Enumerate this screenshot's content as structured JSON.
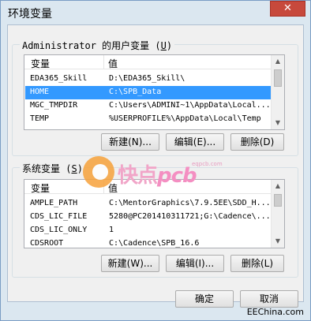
{
  "window": {
    "title": "环境变量",
    "close_label": "✕"
  },
  "user_vars": {
    "label_prefix": "Administrator 的用户变量 (",
    "label_key": "U",
    "label_suffix": ")",
    "col_name": "变量",
    "col_value": "值",
    "rows": [
      {
        "name": "EDA365_Skill",
        "value": "D:\\EDA365_Skill\\"
      },
      {
        "name": "HOME",
        "value": "C:\\SPB_Data"
      },
      {
        "name": "MGC_TMPDIR",
        "value": "C:\\Users\\ADMINI~1\\AppData\\Local..."
      },
      {
        "name": "TEMP",
        "value": "%USERPROFILE%\\AppData\\Local\\Temp"
      }
    ],
    "new_button": "新建(N)...",
    "edit_button": "编辑(E)...",
    "delete_button": "删除(D)"
  },
  "system_vars": {
    "label_prefix": "系统变量 (",
    "label_key": "S",
    "label_suffix": ")",
    "col_name": "变量",
    "col_value": "值",
    "rows": [
      {
        "name": "AMPLE_PATH",
        "value": "C:\\MentorGraphics\\7.9.5EE\\SDD_H..."
      },
      {
        "name": "CDS_LIC_FILE",
        "value": "5280@PC201410311721;G:\\Cadence\\..."
      },
      {
        "name": "CDS_LIC_ONLY",
        "value": "1"
      },
      {
        "name": "CDSROOT",
        "value": "C:\\Cadence\\SPB_16.6"
      }
    ],
    "new_button": "新建(W)...",
    "edit_button": "编辑(I)...",
    "delete_button": "删除(L)"
  },
  "ok_button": "确定",
  "cancel_button": "取消",
  "watermark": {
    "text": "快点",
    "pcb": "pcb",
    "sub": "eqpcb.com"
  },
  "footer": "EEChina.com"
}
